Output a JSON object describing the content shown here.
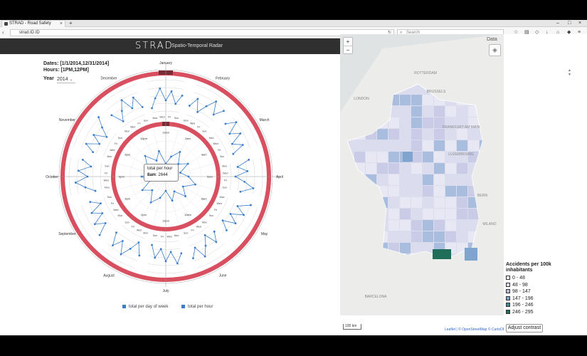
{
  "browser": {
    "tab_title": "STRAD - Road Safety",
    "url": "strad.ID.ID",
    "search_placeholder": "Search"
  },
  "app": {
    "brand": "STRAD",
    "subtitle": "Spatio-Temporal Radar"
  },
  "filters": {
    "dates_label": "Dates: [1/1/2014,12/31/2014]",
    "hours_label": "Hours: [1PM,12PM]",
    "year_label": "Year",
    "year_value": "2014"
  },
  "radar": {
    "months": [
      "January",
      "February",
      "March",
      "April",
      "May",
      "June",
      "July",
      "August",
      "September",
      "October",
      "November",
      "December"
    ],
    "hours": [
      "12am",
      "1am",
      "2am",
      "3am",
      "4am",
      "5am",
      "6am",
      "7am",
      "8am",
      "9am",
      "10am",
      "11am",
      "12pm",
      "1pm",
      "2pm",
      "3pm",
      "4pm",
      "5pm",
      "6pm",
      "7pm",
      "8pm",
      "9pm",
      "10pm",
      "11pm"
    ],
    "weekday_labels": [
      "Mon",
      "Tue",
      "Wed",
      "Thu",
      "Fri",
      "Sat",
      "Sun"
    ],
    "colors": {
      "ring": "#d8505f",
      "series": "#3a7ec9",
      "ring_dark": "#7a2c35"
    }
  },
  "tooltip": {
    "line1": "total per hour",
    "hour": "8am",
    "value": "2644"
  },
  "legend_left": {
    "item1": "total per day of week",
    "item2": "total per hour"
  },
  "map": {
    "zoom_in": "+",
    "zoom_out": "−",
    "data_label": "Data",
    "cities": [
      "LONDON",
      "ROTTERDAM",
      "BRUSSELS",
      "FRANKFURT AM MAIN",
      "LUXEMBOURG",
      "BERN",
      "MILANO",
      "BARCELONA"
    ],
    "scale_label": "100 km",
    "attribution": "Leaflet | © OpenStreetMap © CartoDB"
  },
  "map_legend": {
    "title": "Accidents per 100k inhabitants",
    "ranges": [
      {
        "label": "0 - 48",
        "color": "#f3f2f9"
      },
      {
        "label": "48 - 98",
        "color": "#dcdcef"
      },
      {
        "label": "98 - 147",
        "color": "#b9bde0"
      },
      {
        "label": "147 - 196",
        "color": "#7fa5cf"
      },
      {
        "label": "196 - 246",
        "color": "#3d8a9b"
      },
      {
        "label": "246 - 295",
        "color": "#1f6e5a"
      }
    ],
    "adjust_button": "Adjust contrast"
  }
}
